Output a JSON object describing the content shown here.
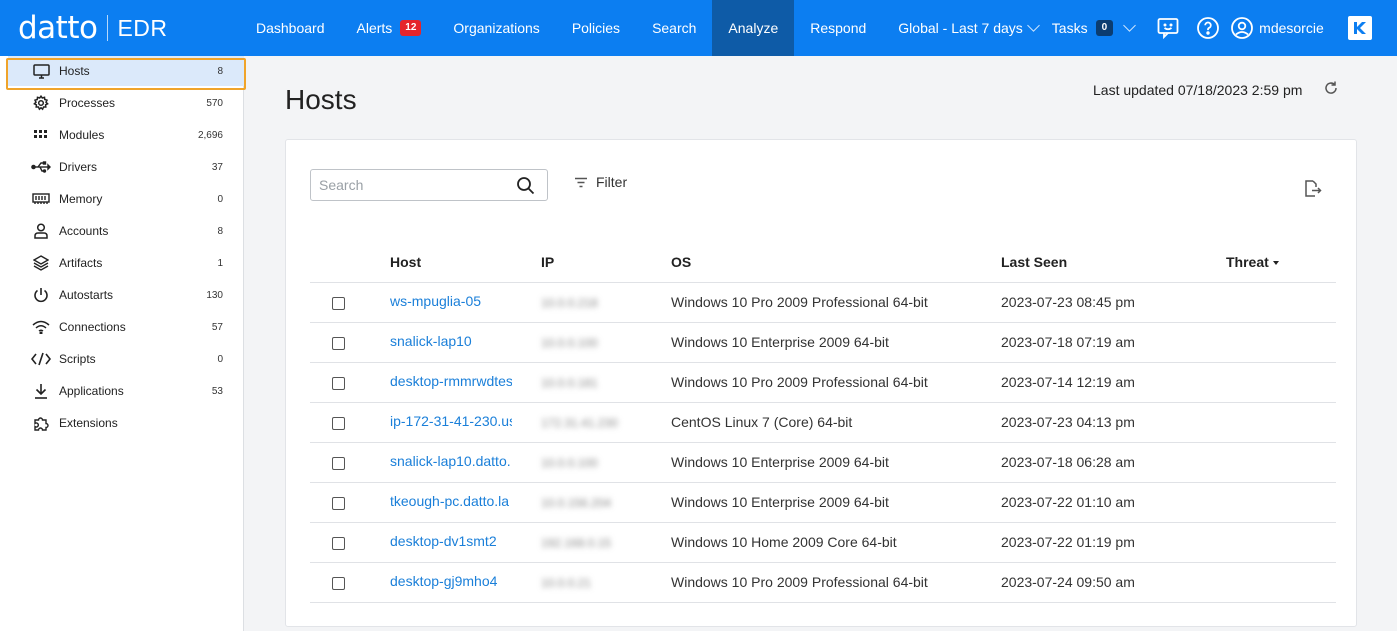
{
  "brand": {
    "logo": "datto",
    "product": "EDR"
  },
  "nav": [
    {
      "label": "Dashboard"
    },
    {
      "label": "Alerts",
      "badge": "12"
    },
    {
      "label": "Organizations"
    },
    {
      "label": "Policies"
    },
    {
      "label": "Search"
    },
    {
      "label": "Analyze",
      "active": true
    },
    {
      "label": "Respond"
    }
  ],
  "header_right": {
    "scope": "Global - Last 7 days",
    "tasks_label": "Tasks",
    "tasks_count": "0",
    "username": "mdesorcie"
  },
  "sidebar": {
    "items": [
      {
        "label": "Hosts",
        "count": "8",
        "icon": "monitor-icon",
        "active": true
      },
      {
        "label": "Processes",
        "count": "570",
        "icon": "gear-icon"
      },
      {
        "label": "Modules",
        "count": "2,696",
        "icon": "modules-grid-icon"
      },
      {
        "label": "Drivers",
        "count": "37",
        "icon": "usb-icon"
      },
      {
        "label": "Memory",
        "count": "0",
        "icon": "memory-icon"
      },
      {
        "label": "Accounts",
        "count": "8",
        "icon": "person-icon"
      },
      {
        "label": "Artifacts",
        "count": "1",
        "icon": "layers-icon"
      },
      {
        "label": "Autostarts",
        "count": "130",
        "icon": "power-icon"
      },
      {
        "label": "Connections",
        "count": "57",
        "icon": "wifi-icon"
      },
      {
        "label": "Scripts",
        "count": "0",
        "icon": "code-icon"
      },
      {
        "label": "Applications",
        "count": "53",
        "icon": "download-icon"
      },
      {
        "label": "Extensions",
        "count": "",
        "icon": "puzzle-icon"
      }
    ]
  },
  "main": {
    "title": "Hosts",
    "last_updated": "Last updated 07/18/2023 2:59 pm",
    "search_placeholder": "Search",
    "filter_label": "Filter",
    "columns": {
      "host": "Host",
      "ip": "IP",
      "os": "OS",
      "last_seen": "Last Seen",
      "threat": "Threat"
    },
    "rows": [
      {
        "host": "ws-mpuglia-05",
        "ip": "10.0.0.218",
        "os": "Windows 10 Pro 2009 Professional 64-bit",
        "last_seen": "2023-07-23 08:45 pm"
      },
      {
        "host": "snalick-lap10",
        "ip": "10.0.0.100",
        "os": "Windows 10 Enterprise 2009 64-bit",
        "last_seen": "2023-07-18 07:19 am"
      },
      {
        "host": "desktop-rmmrwdtest",
        "ip": "10.0.0.181",
        "os": "Windows 10 Pro 2009 Professional 64-bit",
        "last_seen": "2023-07-14 12:19 am"
      },
      {
        "host": "ip-172-31-41-230.us",
        "ip": "172.31.41.230",
        "os": "CentOS Linux 7 (Core) 64-bit",
        "last_seen": "2023-07-23 04:13 pm"
      },
      {
        "host": "snalick-lap10.datto.",
        "ip": "10.0.0.100",
        "os": "Windows 10 Enterprise 2009 64-bit",
        "last_seen": "2023-07-18 06:28 am"
      },
      {
        "host": "tkeough-pc.datto.la",
        "ip": "10.0.156.204",
        "os": "Windows 10 Enterprise 2009 64-bit",
        "last_seen": "2023-07-22 01:10 am"
      },
      {
        "host": "desktop-dv1smt2",
        "ip": "192.168.0.15",
        "os": "Windows 10 Home 2009 Core 64-bit",
        "last_seen": "2023-07-22 01:19 pm"
      },
      {
        "host": "desktop-gj9mho4",
        "ip": "10.0.0.21",
        "os": "Windows 10 Pro 2009 Professional 64-bit",
        "last_seen": "2023-07-24 09:50 am"
      }
    ]
  },
  "colors": {
    "topbar": "#0c7ef1",
    "active_nav": "#0e5ba7",
    "link": "#1a7fd9",
    "highlight": "#f0a42a",
    "alert_badge": "#e5242b"
  }
}
